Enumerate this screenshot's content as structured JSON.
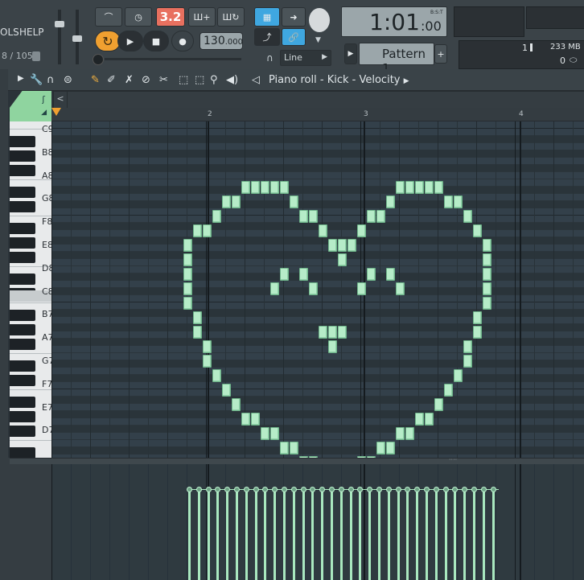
{
  "menu": {
    "tools": "OLS",
    "help": "HELP",
    "cpu": "8 / 105"
  },
  "transport": {
    "pattern_song": "3.2",
    "tempo": "130",
    "tempo_frac": ".000",
    "time_big": "1:01",
    "time_small": ":00",
    "time_mode": "B:S:T",
    "pattern": "Pattern 1",
    "snap": "Line"
  },
  "stats": {
    "cpu_num": "1",
    "mem": "233 MB",
    "poly": "0"
  },
  "toolbar": {
    "title": "Piano roll",
    "sep1": "-",
    "instrument": "Kick",
    "sep2": "-",
    "target": "Velocity"
  },
  "ruler": {
    "bars": [
      "2",
      "3",
      "4"
    ]
  },
  "keys": {
    "labels": [
      "C9",
      "B8",
      "A8",
      "G8",
      "F8",
      "E8",
      "D8",
      "C8",
      "B7",
      "A7",
      "G7",
      "F7",
      "E7",
      "D7"
    ]
  },
  "icons": {
    "pencil": "pencil-icon",
    "brush": "brush-icon",
    "delete": "delete-icon",
    "mute": "mute-icon",
    "slice": "slice-icon",
    "select": "select-icon",
    "zoom": "zoom-icon",
    "playback": "playback-icon",
    "wrench": "wrench-icon",
    "magnet": "magnet-icon",
    "menu": "menu-icon",
    "arrow": "arrow-icon",
    "speaker": "speaker-icon"
  },
  "colors": {
    "note": "#b6ecc8",
    "grid_bg": "#2f3a40",
    "accent_orange": "#f0a030",
    "accent_blue": "#3fa7e0"
  }
}
